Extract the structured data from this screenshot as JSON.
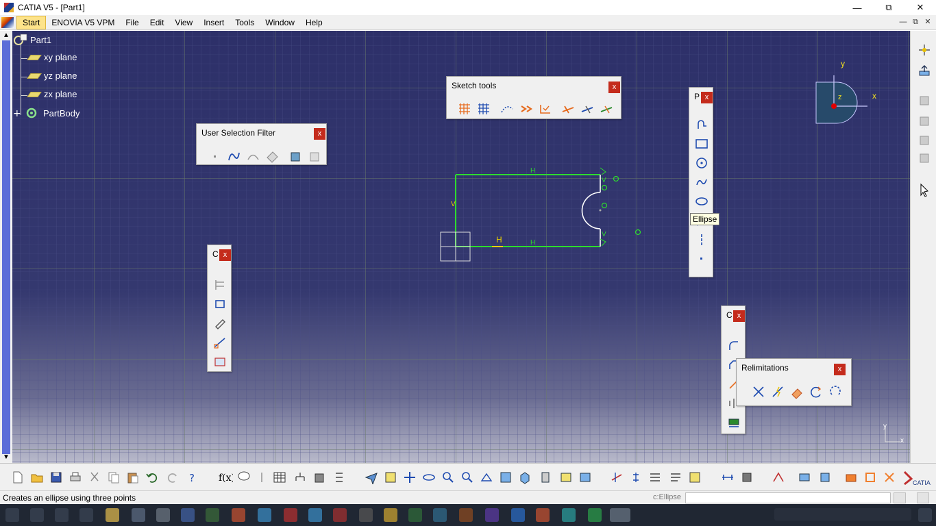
{
  "window": {
    "title": "CATIA V5 - [Part1]",
    "controls": [
      "minimize",
      "restore",
      "close"
    ]
  },
  "menubar": {
    "items": [
      "Start",
      "ENOVIA V5 VPM",
      "File",
      "Edit",
      "View",
      "Insert",
      "Tools",
      "Window",
      "Help"
    ]
  },
  "spec_tree": {
    "root": "Part1",
    "children": [
      "xy plane",
      "yz plane",
      "zx plane",
      "PartBody"
    ]
  },
  "toolbars": {
    "sketch_tools": {
      "title": "Sketch tools",
      "close": "x"
    },
    "user_selection_filter": {
      "title": "User Selection Filter",
      "close": "x"
    },
    "constraint_small": {
      "title": "C",
      "close": "x"
    },
    "profile": {
      "title": "P",
      "close": "x"
    },
    "operation_small": {
      "title": "C",
      "close": "x"
    },
    "relimitations": {
      "title": "Relimitations",
      "close": "x"
    }
  },
  "tooltip": {
    "text": "Ellipse"
  },
  "sketch": {
    "constraint_labels": [
      "H",
      "H",
      "H",
      "V",
      "V"
    ],
    "accent_color": "#00e000",
    "constraint_color": "#e8d000"
  },
  "compass": {
    "x_label": "x",
    "y_label": "y",
    "z_label": "z"
  },
  "axis_corner": {
    "x_label": "x",
    "y_label": "y"
  },
  "statusbar": {
    "message": "Creates an ellipse using three points",
    "command_label": "c:Ellipse",
    "command_value": ""
  },
  "icons": {
    "right_toolbar": [
      "compass-icon",
      "exit-workbench-icon",
      "part-icon",
      "part-icon",
      "part-icon",
      "part-icon",
      "select-arrow-icon"
    ],
    "bottom_toolbar": [
      "new-icon",
      "open-icon",
      "save-icon",
      "print-icon",
      "cut-icon",
      "copy-icon",
      "paste-icon",
      "undo-icon",
      "redo-icon",
      "whats-this-icon",
      "formula-icon",
      "comment-icon",
      "knowledge-icon",
      "table-icon",
      "tree-icon",
      "catalog-icon",
      "parameters-icon",
      "fly-icon",
      "fit-all-icon",
      "pan-icon",
      "rotate-icon",
      "zoom-in-icon",
      "zoom-out-icon",
      "normal-view-icon",
      "iso-view-icon",
      "view-mode-icon",
      "hide-show-icon",
      "swap-space-icon",
      "shading-icon",
      "constraint-icon",
      "geometry-icon",
      "edit-multi-icon",
      "snap-icon",
      "analysis-icon",
      "measure-icon",
      "apply-material-icon",
      "2d-view-icon",
      "insert-icon",
      "pad-icon",
      "pocket-icon",
      "catia-logo-icon"
    ]
  }
}
